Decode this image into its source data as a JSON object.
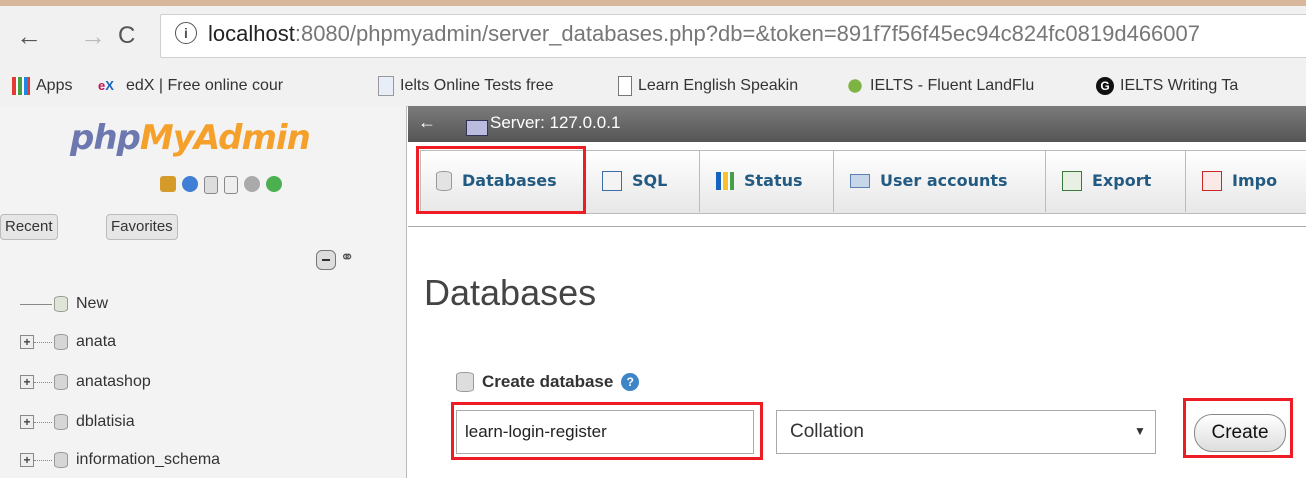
{
  "browser": {
    "url_host": "localhost",
    "url_rest": ":8080/phpmyadmin/server_databases.php?db=&token=891f7f56f45ec94c824fc0819d466007",
    "info_glyph": "i",
    "bookmarks": [
      {
        "label": "Apps",
        "icon": "apps-grid-icon"
      },
      {
        "label": "edX | Free online cour",
        "icon": "edx-icon"
      },
      {
        "label": "Ielts Online Tests free",
        "icon": "page-icon"
      },
      {
        "label": "Learn English Speakin",
        "icon": "page-icon"
      },
      {
        "label": "IELTS - Fluent LandFlu",
        "icon": "tree-icon"
      },
      {
        "label": "IELTS Writing Ta",
        "icon": "g-icon"
      }
    ]
  },
  "sidebar": {
    "logo_php": "php",
    "logo_myadmin": "MyAdmin",
    "recent_label": "Recent",
    "favorites_label": "Favorites",
    "tree": [
      {
        "label": "New"
      },
      {
        "label": "anata"
      },
      {
        "label": "anatashop"
      },
      {
        "label": "dblatisia"
      },
      {
        "label": "information_schema"
      }
    ]
  },
  "main": {
    "server_label": "Server: 127.0.0.1",
    "tabs": [
      {
        "label": "Databases"
      },
      {
        "label": "SQL"
      },
      {
        "label": "Status"
      },
      {
        "label": "User accounts"
      },
      {
        "label": "Export"
      },
      {
        "label": "Impo"
      }
    ],
    "page_title": "Databases",
    "create_label": "Create database",
    "dbname_value": "learn-login-register",
    "collation_value": "Collation",
    "create_button": "Create"
  },
  "colors": {
    "highlight": "#ee1c25",
    "tab_text": "#235a81",
    "logo_blue": "#6c78af",
    "logo_orange": "#f6a02c"
  }
}
